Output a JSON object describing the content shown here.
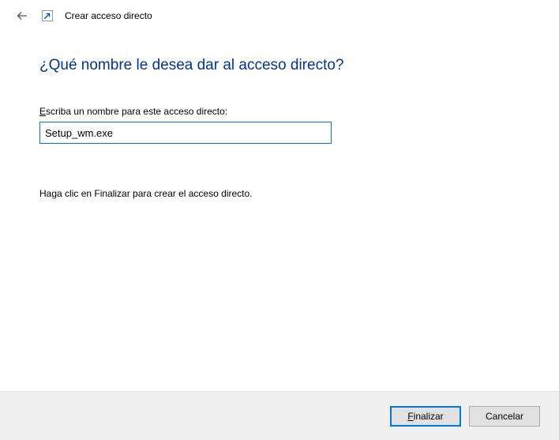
{
  "header": {
    "title": "Crear acceso directo"
  },
  "main": {
    "heading": "¿Qué nombre le desea dar al acceso directo?",
    "label_prefix_underlined": "E",
    "label_rest": "scriba un nombre para este acceso directo:",
    "input_value": "Setup_wm.exe",
    "hint": "Haga clic en Finalizar para crear el acceso directo."
  },
  "footer": {
    "finish_prefix_underlined": "F",
    "finish_rest": "inalizar",
    "cancel": "Cancelar"
  }
}
